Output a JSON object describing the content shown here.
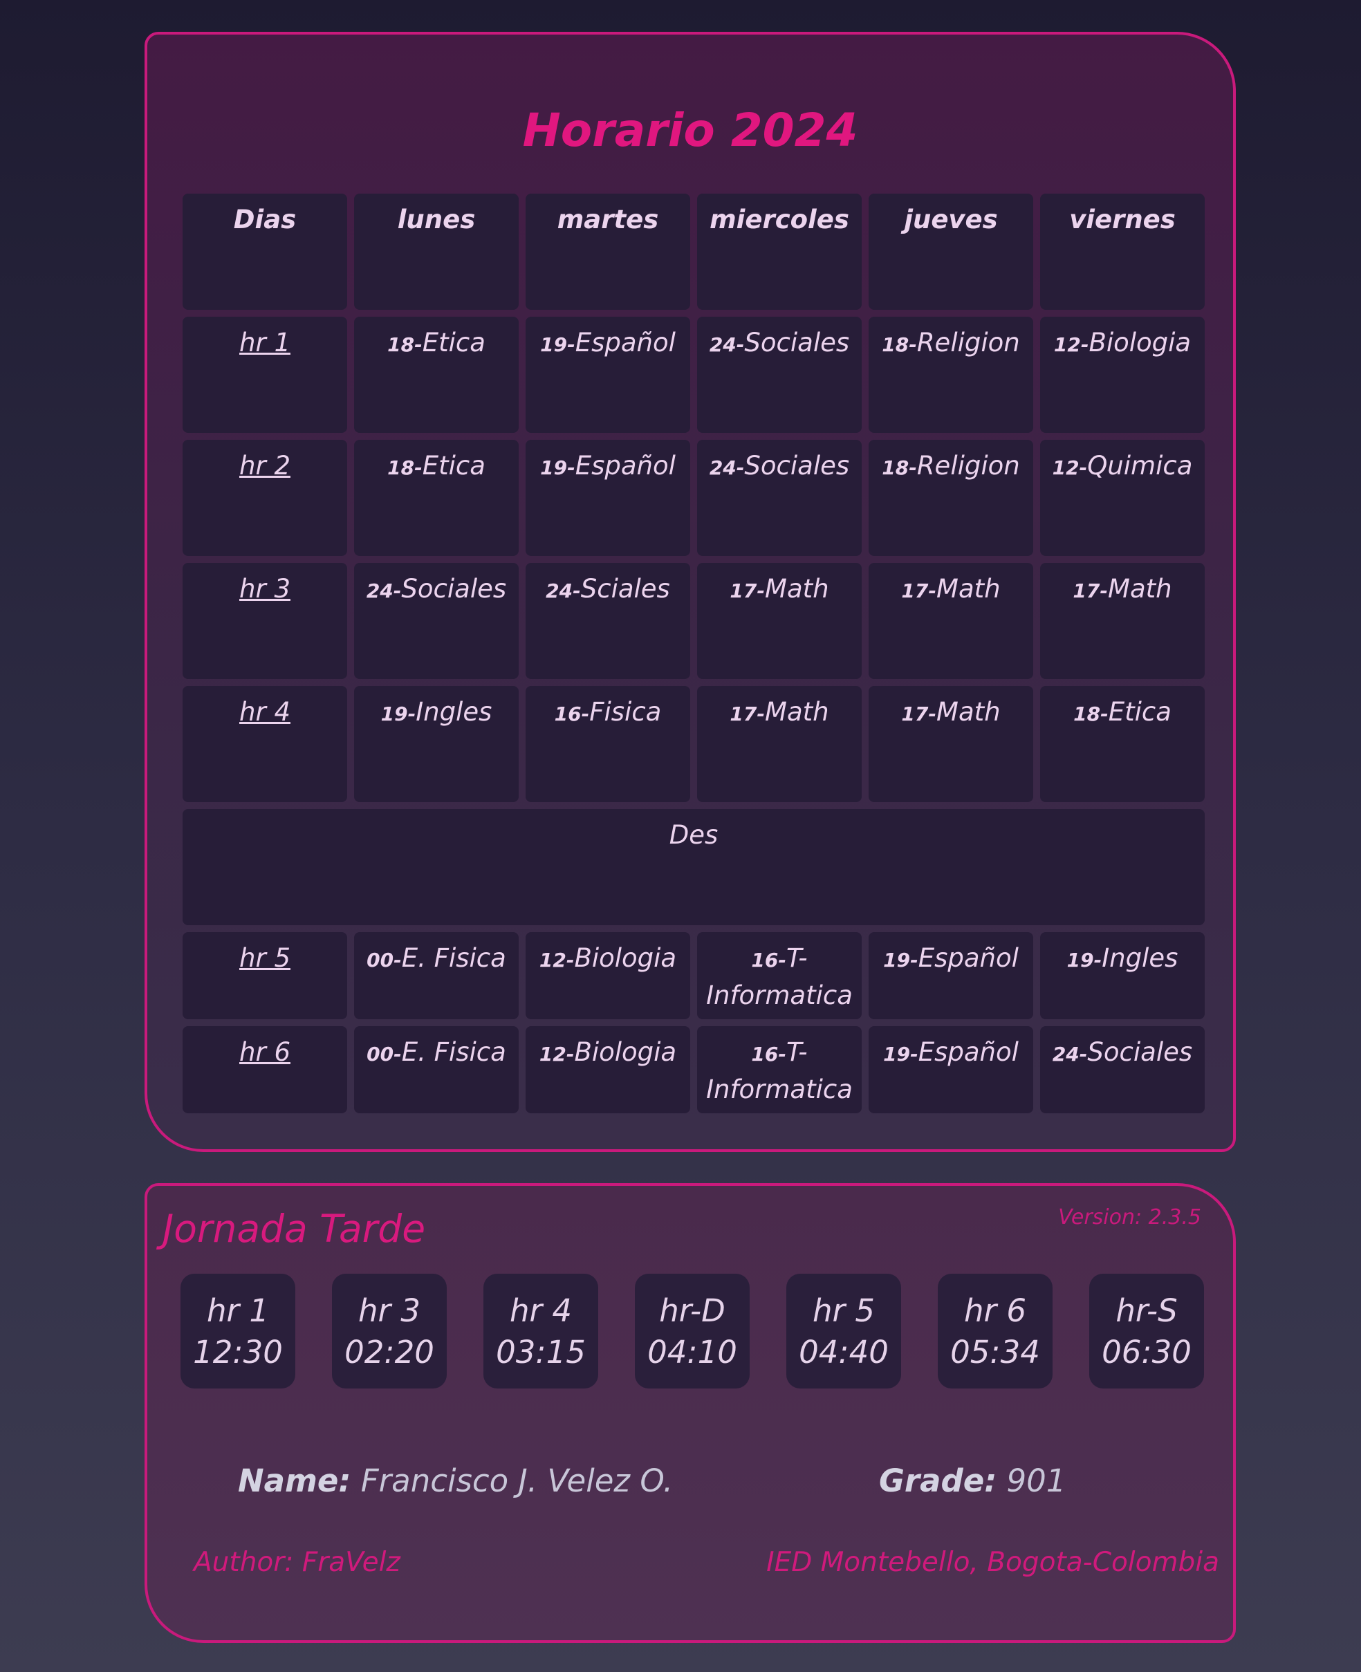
{
  "schedule": {
    "title": "Horario 2024",
    "headers": [
      "Dias",
      "lunes",
      "martes",
      "miercoles",
      "jueves",
      "viernes"
    ],
    "rows": [
      {
        "hour": "hr 1",
        "cells": [
          [
            "18-",
            "Etica"
          ],
          [
            "19-",
            "Español"
          ],
          [
            "24-",
            "Sociales"
          ],
          [
            "18-",
            "Religion"
          ],
          [
            "12-",
            "Biologia"
          ]
        ]
      },
      {
        "hour": "hr 2",
        "cells": [
          [
            "18-",
            "Etica"
          ],
          [
            "19-",
            "Español"
          ],
          [
            "24-",
            "Sociales"
          ],
          [
            "18-",
            "Religion"
          ],
          [
            "12-",
            "Quimica"
          ]
        ]
      },
      {
        "hour": "hr 3",
        "cells": [
          [
            "24-",
            "Sociales"
          ],
          [
            "24-",
            "Sciales"
          ],
          [
            "17-",
            "Math"
          ],
          [
            "17-",
            "Math"
          ],
          [
            "17-",
            "Math"
          ]
        ]
      },
      {
        "hour": "hr 4",
        "cells": [
          [
            "19-",
            "Ingles"
          ],
          [
            "16-",
            "Fisica"
          ],
          [
            "17-",
            "Math"
          ],
          [
            "17-",
            "Math"
          ],
          [
            "18-",
            "Etica"
          ]
        ]
      }
    ],
    "break_label": "Des",
    "rows_after": [
      {
        "hour": "hr 5",
        "cells": [
          [
            "00-",
            "E. Fisica"
          ],
          [
            "12-",
            "Biologia"
          ],
          [
            "16-",
            "T-Informatica"
          ],
          [
            "19-",
            "Español"
          ],
          [
            "19-",
            "Ingles"
          ]
        ]
      },
      {
        "hour": "hr 6",
        "cells": [
          [
            "00-",
            "E. Fisica"
          ],
          [
            "12-",
            "Biologia"
          ],
          [
            "16-",
            "T-Informatica"
          ],
          [
            "19-",
            "Español"
          ],
          [
            "24-",
            "Sociales"
          ]
        ]
      }
    ]
  },
  "info": {
    "jornada": "Jornada Tarde",
    "version": "Version: 2.3.5",
    "times": [
      {
        "label": "hr 1",
        "time": "12:30"
      },
      {
        "label": "hr 3",
        "time": "02:20"
      },
      {
        "label": "hr 4",
        "time": "03:15"
      },
      {
        "label": "hr-D",
        "time": "04:10"
      },
      {
        "label": "hr 5",
        "time": "04:40"
      },
      {
        "label": "hr 6",
        "time": "05:34"
      },
      {
        "label": "hr-S",
        "time": "06:30"
      }
    ],
    "name_label": "Name:",
    "name_value": "Francisco J. Velez O.",
    "grade_label": "Grade:",
    "grade_value": "901",
    "author": "Author: FraVelz",
    "school": "IED Montebello, Bogota-Colombia"
  },
  "colors": {
    "accent": "#e0177f",
    "border": "#c91a7c",
    "cell_bg": "#271d38"
  }
}
